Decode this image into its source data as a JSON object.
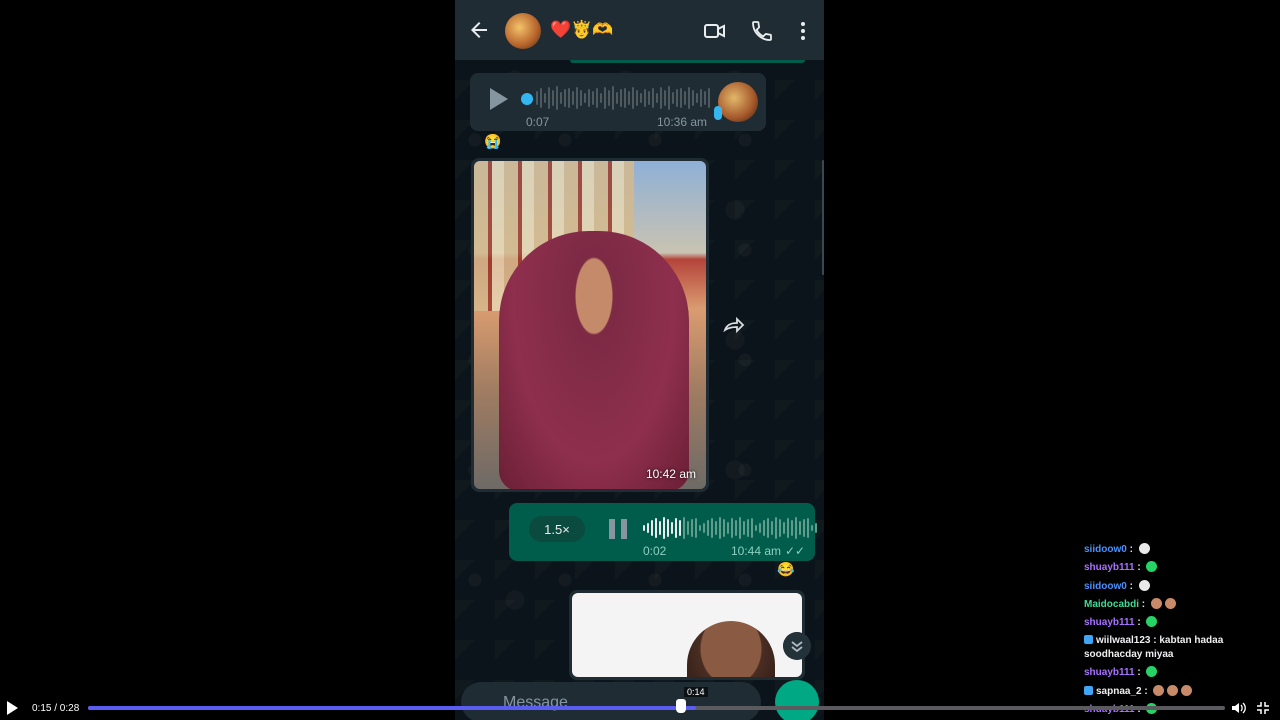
{
  "header": {
    "contact_name": "❤️🤴🫶",
    "icons": [
      "back-arrow-icon",
      "video-call-icon",
      "phone-call-icon",
      "more-vertical-icon"
    ]
  },
  "messages": {
    "voice_in": {
      "duration": "0:07",
      "time": "10:36 am"
    },
    "reaction_1": "😭",
    "video": {
      "time": "10:42 am"
    },
    "voice_out": {
      "speed": "1.5×",
      "position": "0:02",
      "time": "10:44 am",
      "status": "✓✓"
    },
    "reaction_2": "😂"
  },
  "composer": {
    "placeholder": "Message"
  },
  "chat_overlay": [
    {
      "user": "siidoow0",
      "color": "#4a90ff",
      "text": "",
      "emotes": [
        "#e9e9e9"
      ]
    },
    {
      "user": "shuayb111",
      "color": "#a970ff",
      "text": "",
      "emotes": [
        "#25d366"
      ]
    },
    {
      "user": "siidoow0",
      "color": "#4a90ff",
      "text": "",
      "emotes": [
        "#e9e9e9"
      ]
    },
    {
      "user": "Maidocabdi",
      "color": "#3ddc97",
      "text": "",
      "emotes": [
        "#c98a6a",
        "#c98a6a"
      ]
    },
    {
      "user": "shuayb111",
      "color": "#a970ff",
      "text": "",
      "emotes": [
        "#25d366"
      ]
    },
    {
      "user": "wiilwaal123",
      "color": "#efeff1",
      "text": "kabtan hadaa soodhacday miyaa",
      "emotes": []
    },
    {
      "user": "shuayb111",
      "color": "#a970ff",
      "text": "",
      "emotes": [
        "#25d366"
      ]
    },
    {
      "user": "sapnaa_2",
      "color": "#efeff1",
      "text": "",
      "emotes": [
        "#c98a6a",
        "#c98a6a",
        "#c98a6a"
      ]
    },
    {
      "user": "shuayb111",
      "color": "#a970ff",
      "text": "",
      "emotes": [
        "#25d366"
      ]
    }
  ],
  "player": {
    "timecode": "0:15 / 0:28",
    "hover_time": "0:14",
    "progress": 0.535
  },
  "colors": {
    "accent": "#5b5cf0",
    "wa_green": "#005c4b",
    "wa_dark": "#0b141a"
  }
}
